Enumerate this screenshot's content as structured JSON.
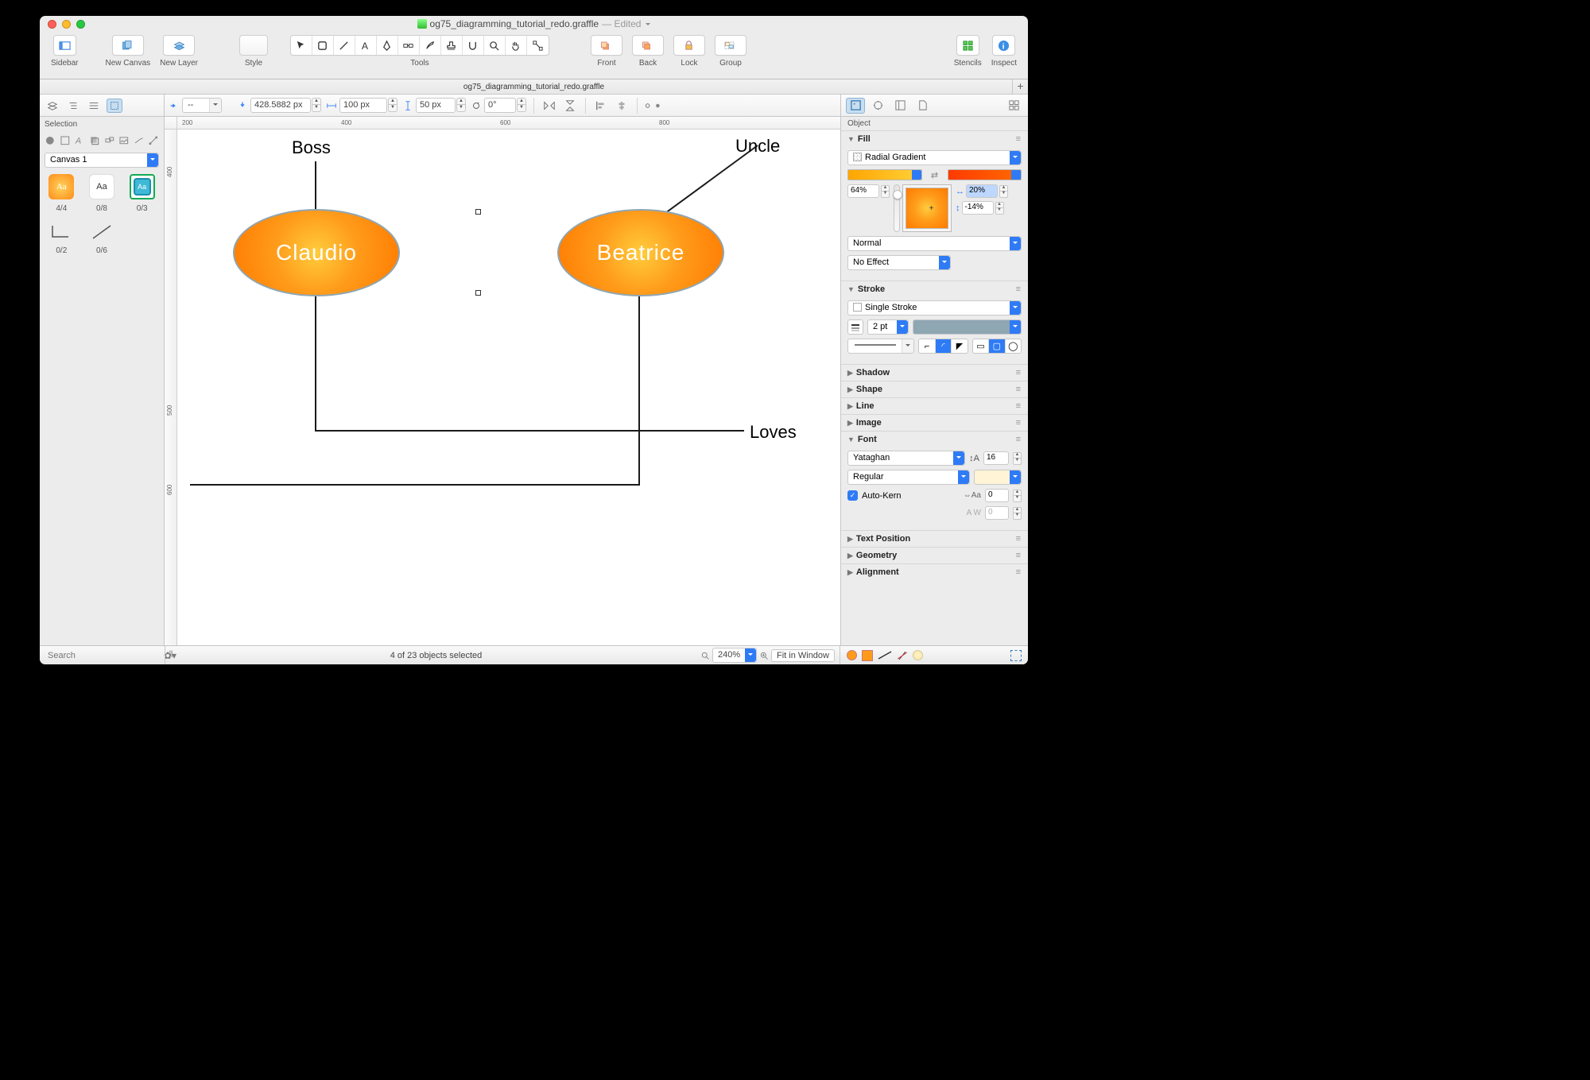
{
  "window": {
    "filename": "og75_diagramming_tutorial_redo.graffle",
    "status": "— Edited"
  },
  "toolbar": {
    "sidebar": "Sidebar",
    "new_canvas": "New Canvas",
    "new_layer": "New Layer",
    "style": "Style",
    "tools": "Tools",
    "front": "Front",
    "back": "Back",
    "lock": "Lock",
    "group": "Group",
    "stencils": "Stencils",
    "inspect": "Inspect"
  },
  "docbar": {
    "filename": "og75_diagramming_tutorial_redo.graffle"
  },
  "geom_bar": {
    "x_label": "--",
    "x_value": "428.5882 px",
    "w_value": "100 px",
    "h_value": "50 px",
    "rot_value": "0°"
  },
  "sidebar_left": {
    "section_label": "Selection",
    "canvas": "Canvas 1",
    "thumbs": {
      "a": "Aa",
      "b": "Aa",
      "c": "Aa",
      "count_a": "4/4",
      "count_b": "0/8",
      "count_c": "0/3"
    },
    "lines": {
      "a": "0/2",
      "b": "0/6"
    }
  },
  "canvas": {
    "label_boss": "Boss",
    "label_uncle": "Uncle",
    "label_loves": "Loves",
    "node_claudio": "Claudio",
    "node_beatrice": "Beatrice",
    "ruler_h": [
      "200",
      "400",
      "600",
      "800"
    ],
    "ruler_v": [
      "400",
      "500",
      "600"
    ]
  },
  "inspector": {
    "section_label": "Object",
    "fill": {
      "title": "Fill",
      "type": "Radial Gradient",
      "color1": "#ffc23a",
      "color2": "#ff6a00",
      "opacity": "64%",
      "cx": "20%",
      "cy": "-14%",
      "blend": "Normal",
      "effect": "No Effect"
    },
    "stroke": {
      "title": "Stroke",
      "type": "Single Stroke",
      "width": "2 pt"
    },
    "shadow": "Shadow",
    "shape": "Shape",
    "line": "Line",
    "image": "Image",
    "font": {
      "title": "Font",
      "family": "Yataghan",
      "size": "16",
      "weight": "Regular",
      "autokern": "Auto-Kern",
      "spacing": "0",
      "tracking": "0"
    },
    "text_position": "Text Position",
    "geometry": "Geometry",
    "alignment": "Alignment"
  },
  "statusbar": {
    "search_placeholder": "Search",
    "selection": "4 of 23 objects selected",
    "zoom": "240%",
    "fit": "Fit in Window"
  }
}
